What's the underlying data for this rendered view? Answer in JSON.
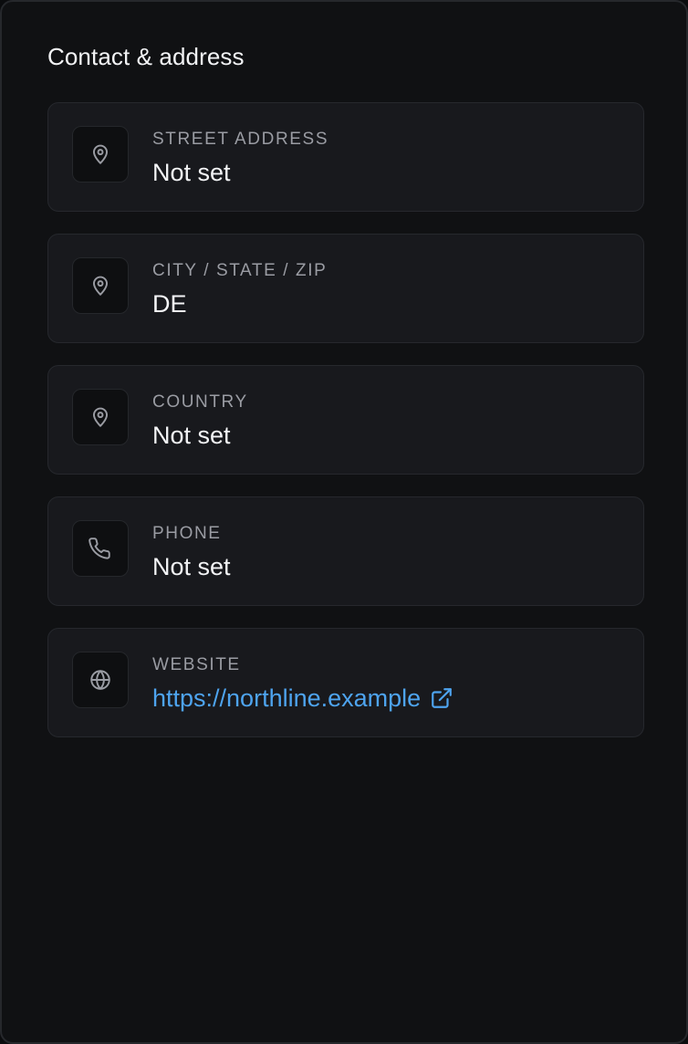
{
  "panel": {
    "title": "Contact & address"
  },
  "rows": [
    {
      "icon": "map-pin-icon",
      "label": "STREET ADDRESS",
      "value": "Not set"
    },
    {
      "icon": "map-pin-icon",
      "label": "CITY / STATE / ZIP",
      "value": "DE"
    },
    {
      "icon": "map-pin-icon",
      "label": "COUNTRY",
      "value": "Not set"
    },
    {
      "icon": "phone-icon",
      "label": "PHONE",
      "value": "Not set"
    },
    {
      "icon": "globe-icon",
      "label": "WEBSITE",
      "value": "https://northline.example",
      "value_icon": "external-link-icon"
    }
  ],
  "colors": {
    "background": "#101113",
    "card": "#18191d",
    "label": "#9a9ca3",
    "value": "#f3f4f6",
    "link": "#4ea4ef"
  }
}
